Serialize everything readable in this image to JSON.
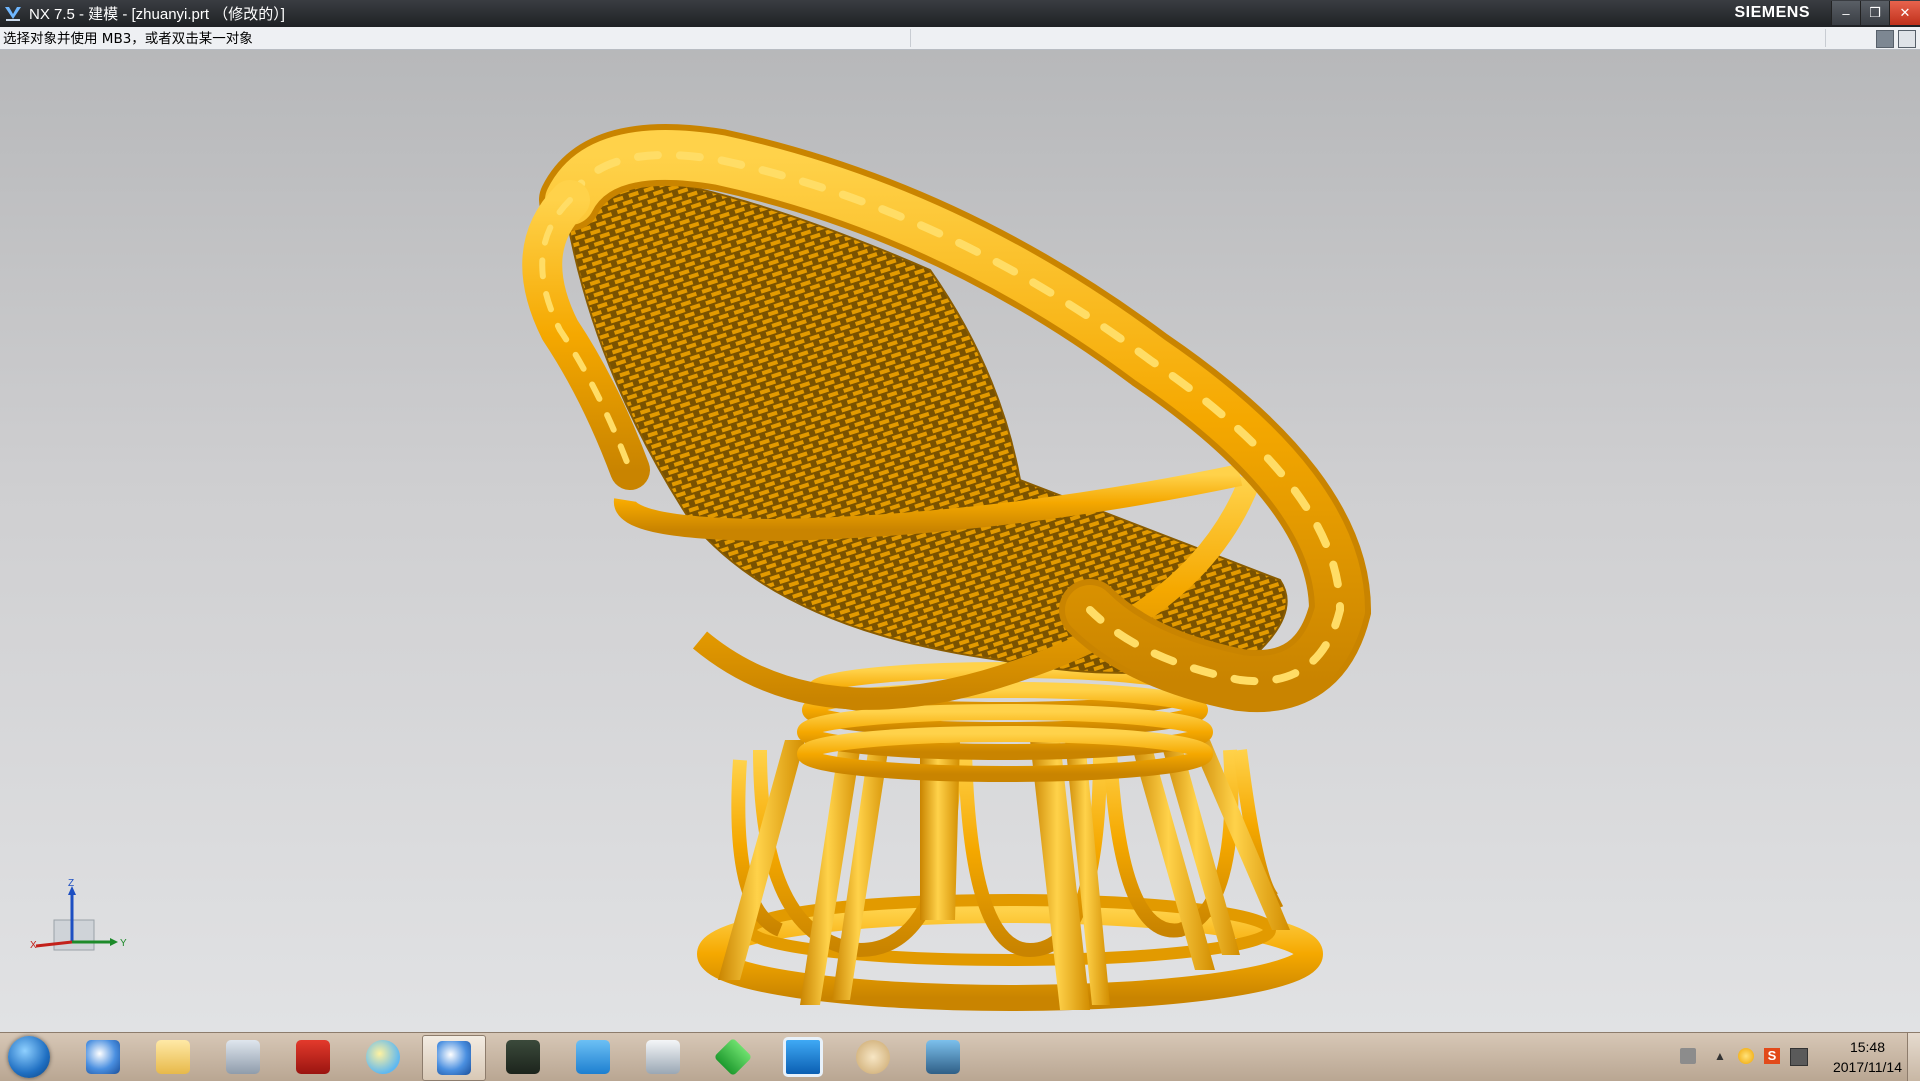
{
  "window": {
    "title": "NX 7.5 - 建模 - [zhuanyi.prt （修改的）]",
    "brand": "SIEMENS",
    "minimize": "–",
    "restore": "❒",
    "close": "✕"
  },
  "cue_line": {
    "text": "选择对象并使用 MB3，或者双击某一对象"
  },
  "triad": {
    "z_label": "Z",
    "x_label": "X",
    "y_label": "Y"
  },
  "taskbar": {
    "apps": [
      {
        "icon": "nx-icon",
        "active": false
      },
      {
        "icon": "folder-icon",
        "active": false
      },
      {
        "icon": "calculator-icon",
        "active": false
      },
      {
        "icon": "autocad-icon",
        "active": false
      },
      {
        "icon": "chat-icon",
        "active": false
      },
      {
        "icon": "nx-icon",
        "active": true
      },
      {
        "icon": "monitor-icon",
        "active": false
      },
      {
        "icon": "qq-icon",
        "active": false
      },
      {
        "icon": "window-icon",
        "active": false
      },
      {
        "icon": "download-icon",
        "active": false
      },
      {
        "icon": "blue-square-icon",
        "active": false
      },
      {
        "icon": "paint-icon",
        "active": false
      },
      {
        "icon": "picture-viewer-icon",
        "active": false
      }
    ]
  },
  "tray": {
    "time": "15:48",
    "date": "2017/11/14"
  },
  "colors": {
    "model": "#f5a800",
    "model_dark": "#c98400",
    "model_light": "#ffd24a"
  }
}
